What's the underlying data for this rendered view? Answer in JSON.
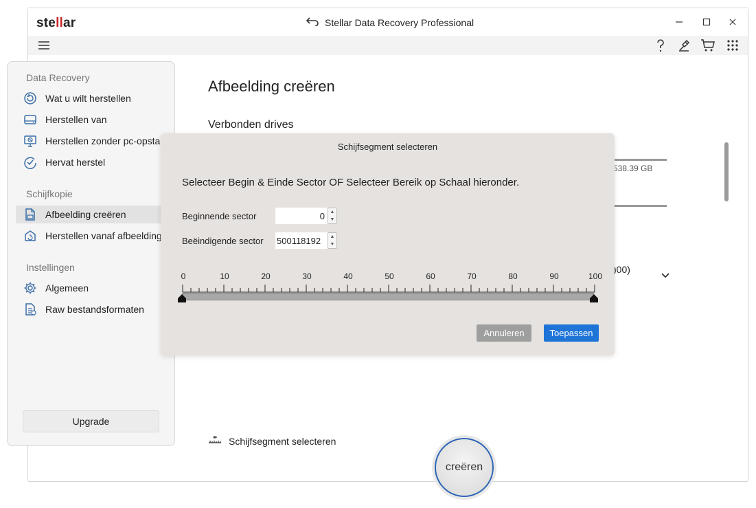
{
  "app": {
    "logo_text": "stellar",
    "title": "Stellar Data Recovery Professional",
    "window_controls": {
      "minimize": "–",
      "maximize": "☐",
      "close": "✕"
    }
  },
  "toolbar": {
    "menu_icon": "hamburger-menu-icon",
    "right_icons": [
      "help-icon",
      "tools-icon",
      "cart-icon",
      "apps-grid-icon"
    ]
  },
  "sidebar": {
    "sections": [
      {
        "heading": "Data Recovery",
        "items": [
          {
            "label": "Wat u wilt herstellen",
            "icon": "restore-circle-icon"
          },
          {
            "label": "Herstellen van",
            "icon": "drive-icon"
          },
          {
            "label": "Herstellen zonder pc-opstart",
            "icon": "monitor-off-icon"
          },
          {
            "label": "Hervat herstel",
            "icon": "resume-check-icon"
          }
        ]
      },
      {
        "heading": "Schijfkopie",
        "items": [
          {
            "label": "Afbeelding creëren",
            "icon": "create-image-icon",
            "active": true
          },
          {
            "label": "Herstellen vanaf afbeelding",
            "icon": "restore-image-icon"
          }
        ]
      },
      {
        "heading": "Instellingen",
        "items": [
          {
            "label": "Algemeen",
            "icon": "gear-icon"
          },
          {
            "label": "Raw bestandsformaten",
            "icon": "raw-file-icon"
          }
        ]
      }
    ],
    "upgrade_label": "Upgrade"
  },
  "main": {
    "page_title": "Afbeelding creëren",
    "section_title": "Verbonden drives",
    "partial_texts": {
      "drive_size": "538.39 GB",
      "drive_paren": ")00)"
    },
    "segment_link_label": "Schijfsegment selecteren",
    "create_button_label": "creëren"
  },
  "dialog": {
    "title": "Schijfsegment selecteren",
    "instruction": "Selecteer Begin & Einde Sector OF Selecteer Bereik op Schaal hieronder.",
    "start_label": "Beginnende sector",
    "start_value": "0",
    "end_label": "Beëindigende sector",
    "end_value": "500118192",
    "scale_labels": [
      "0",
      "10",
      "20",
      "30",
      "40",
      "50",
      "60",
      "70",
      "80",
      "90",
      "100"
    ],
    "range_start_percent": 0,
    "range_end_percent": 100,
    "cancel_label": "Annuleren",
    "apply_label": "Toepassen"
  },
  "colors": {
    "accent": "#1e74d7",
    "sidebar_icon": "#3b6fa8",
    "logo_accent": "#c62828",
    "create_ring": "#2d65b5"
  }
}
